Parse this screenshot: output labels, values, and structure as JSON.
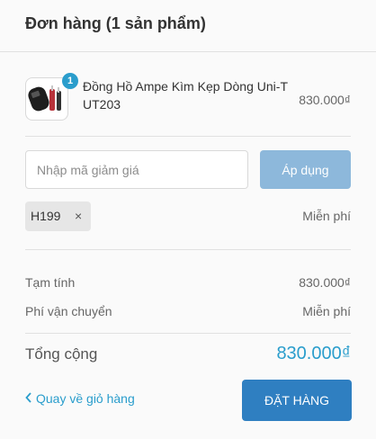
{
  "header": {
    "title": "Đơn hàng (1 sản phẩm)"
  },
  "product": {
    "image_icon": "product-photo-clamp-meter",
    "quantity": "1",
    "name": "Đồng Hồ Ampe Kìm Kẹp Dòng Uni-T UT203",
    "price": "830.000₫"
  },
  "discount": {
    "placeholder": "Nhập mã giảm giá",
    "apply_label": "Áp dụng",
    "applied_code": "H199",
    "remove_icon": "close-icon",
    "applied_note": "Miễn phí"
  },
  "summary": {
    "subtotal_label": "Tạm tính",
    "subtotal_value": "830.000₫",
    "shipping_label": "Phí vận chuyển",
    "shipping_value": "Miễn phí",
    "total_label": "Tổng cộng",
    "total_value": "830.000₫"
  },
  "actions": {
    "back_label": "Quay về giỏ hàng",
    "order_label": "ĐẶT HÀNG"
  },
  "colors": {
    "accent": "#2a9dcc",
    "order_button": "#2f7fc1",
    "apply_button": "#8db8db"
  }
}
